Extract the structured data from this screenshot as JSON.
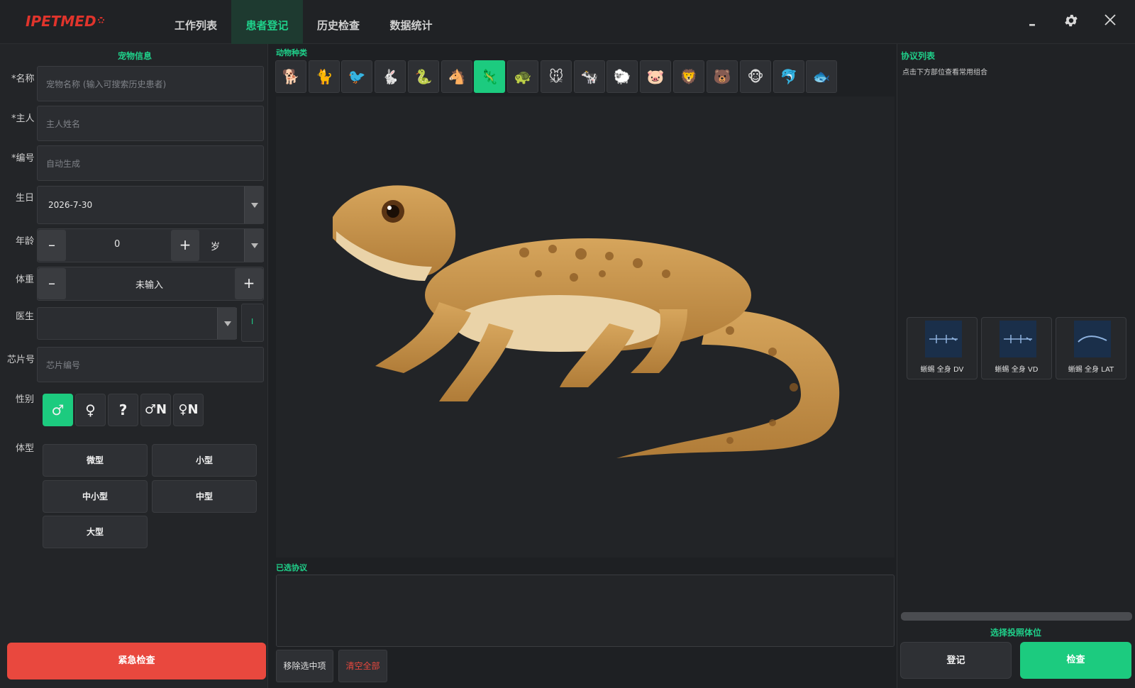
{
  "app": {
    "logo": "IPETMED"
  },
  "nav": {
    "tabs": [
      {
        "label": "工作列表",
        "active": false
      },
      {
        "label": "患者登记",
        "active": true
      },
      {
        "label": "历史检查",
        "active": false
      },
      {
        "label": "数据统计",
        "active": false
      }
    ]
  },
  "window": {
    "minimize": "–",
    "settings_icon": "gear-icon",
    "close_icon": "close-icon"
  },
  "left": {
    "title": "宠物信息",
    "name_label": "*名称",
    "name_placeholder": "宠物名称 (输入可搜索历史患者)",
    "owner_label": "*主人",
    "owner_placeholder": "主人姓名",
    "id_label": "*编号",
    "id_placeholder": "自动生成",
    "birth_label": "生日",
    "birth_value": "2026-7-30",
    "age_label": "年龄",
    "age_value": "0",
    "age_unit": "岁",
    "weight_label": "体重",
    "weight_value": "未输入",
    "doctor_label": "医生",
    "doctor_value": "",
    "doctor_side": "I",
    "chip_label": "芯片号",
    "chip_placeholder": "芯片编号",
    "sex_label": "性别",
    "sex_options": [
      "♂",
      "♀",
      "?",
      "♂N",
      "♀N"
    ],
    "sex_selected": "♂",
    "size_label": "体型",
    "size_options": [
      "微型",
      "小型",
      "中小型",
      "中型",
      "大型"
    ],
    "minus": "–",
    "plus": "+",
    "emergency": "紧急检查"
  },
  "center": {
    "species_title": "动物种类",
    "species": [
      "🐕",
      "🐈",
      "🐦",
      "🐇",
      "🐍",
      "🐴",
      "🦎",
      "🐢",
      "🐭",
      "🐄",
      "🐑",
      "🐷",
      "🦁",
      "🐻",
      "🐵",
      "🐬",
      "🐟"
    ],
    "species_selected": "🦎",
    "selected_title": "已选协议",
    "remove_btn": "移除选中项",
    "clear_btn": "清空全部"
  },
  "right": {
    "title": "协议列表",
    "hint": "点击下方部位查看常用组合",
    "protocols": [
      "蜥蜴 全身 DV",
      "蜥蜴 全身 VD",
      "蜥蜴 全身 LAT"
    ],
    "position_title": "选择投照体位",
    "register_btn": "登记",
    "check_btn": "检查"
  },
  "colors": {
    "accent": "#1ccb7f",
    "danger": "#e9483e",
    "logo": "#e0342c"
  }
}
